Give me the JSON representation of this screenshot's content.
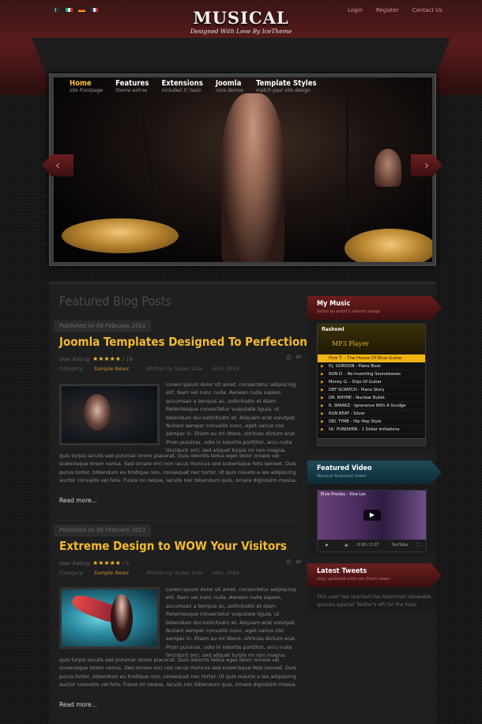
{
  "header": {
    "logo": "MUSICAL",
    "tagline": "Designed With Love By IceTheme",
    "links": [
      "Login",
      "Register",
      "Contact Us"
    ]
  },
  "slideshow": {
    "menu": [
      {
        "title": "Home",
        "sub": "site frontpage"
      },
      {
        "title": "Features",
        "sub": "theme extras"
      },
      {
        "title": "Extensions",
        "sub": "included 3! tools"
      },
      {
        "title": "Joomla",
        "sub": "core demos"
      },
      {
        "title": "Template Styles",
        "sub": "match your site design"
      }
    ],
    "prev_icon": "‹",
    "next_icon": "›"
  },
  "main": {
    "section_title": "Featured Blog Posts",
    "posts": [
      {
        "date": "Published on 08 February 2011",
        "title": "Joomla Templates Designed To Perfection",
        "rating_label": "User Rating:",
        "stars": "★★★★★",
        "rating_count": "/ 19",
        "category_label": "Category:",
        "category": "Sample News",
        "author": "Written by Super User",
        "hits": "Hits: 2343",
        "text_right": "Lorem ipsum dolor sit amet, consectetur adipiscing elit. Nam vel nunc nulla. Aenean nulla sapien, accumsan a tempus ac, sollicitudin et diam. Pellentesque consectetur vulputate ligula, ut bibendum dui sollicitudin et. Aliquam erat volutpat. Nullam semper convallis nunc, eget varius nisl semper in. Etiam eu mi libero, ultricies dictum erat. Proin pulvinar, odio in lobortis porttitor, arcu nulla tincidunt orci, sed aliquet turpis mi non magna. Aenean dictum erat",
        "text_full": "quis turpis iaculis sed pulvinar lorem placerat. Duis lobortis tellus eget dolor ornare vel scelerisque lorem varius. Sed ornare orci non lacus rhoncus sed scelerisque felis laoreet. Duis purus tortor, bibendum eu tristique non, consequat nec tortor. Ut quis mauris a leo adipiscing auctor convallis vel felis. Fusce mi neque, iaculis nec bibendum quis, ornare dignissim massa.",
        "read_more": "Read more..."
      },
      {
        "date": "Published on 08 February 2011",
        "title": "Extreme Design to WOW Your Visitors",
        "rating_label": "User Rating:",
        "stars": "★★★★★",
        "rating_count": "/ 5",
        "category_label": "Category:",
        "category": "Sample News",
        "author": "Written by Super User",
        "hits": "Hits: 2069",
        "text_right": "Lorem ipsum dolor sit amet, consectetur adipiscing elit. Nam vel nunc nulla. Aenean nulla sapien, accumsan a tempus ac, sollicitudin et diam. Pellentesque consectetur vulputate ligula, ut bibendum dui sollicitudin et. Aliquam erat volutpat. Nullam semper convallis nunc, eget varius nisl semper in. Etiam eu mi libero, ultricies dictum erat. Proin pulvinar, odio in lobortis porttitor, arcu nulla tincidunt orci, sed aliquet turpis mi non magna. Aenean dictum erat",
        "text_full": "quis turpis iaculis sed pulvinar lorem placerat. Duis lobortis tellus eget dolor ornare vel scelerisque lorem varius. Sed ornare orci non lacus rhoncus sed scelerisque felis laoreet. Duis purus tortor, bibendum eu tristique non, consequat nec tortor. Ut quis mauris a leo adipiscing auctor convallis vel felis. Fusce mi neque, iaculis nec bibendum quis, ornare dignissim massa.",
        "read_more": "Read more..."
      }
    ]
  },
  "sidebar": {
    "my_music": {
      "title": "My Music",
      "subtitle": "listen to artist's recent songs",
      "brand": "flashxml",
      "player_title": "MP3 Player",
      "now_playing": "Pink T. - The House Of Blue Guitar",
      "tracks": [
        "P.J. GORDON - Piano Buzz",
        "RUN D. - Re-Inventing Soundwaves",
        "Money G. - Dojo Of Guitar",
        "DEF SCRATCH - Piano Story",
        "DR. RHYME - Nuclear Bullet",
        "R. SPARKZ - Ignorance With A Grudge",
        "RUN BEAT - Silver",
        "DEL TYME - Hip Hop Style",
        "OL' PUNISHER - 1 Dollar Imitations"
      ]
    },
    "featured_video": {
      "title": "Featured Video",
      "subtitle": "Musical featured video",
      "video_title": "Elvis Presley - Viva Las",
      "time": "0:00 / 2:27",
      "brand": "YouTube"
    },
    "latest_tweets": {
      "title": "Latest Tweets",
      "subtitle": "stay updated with our fresh news",
      "text": "This user has reached the maximum allowable queries against Twitter's API for the hour."
    }
  }
}
